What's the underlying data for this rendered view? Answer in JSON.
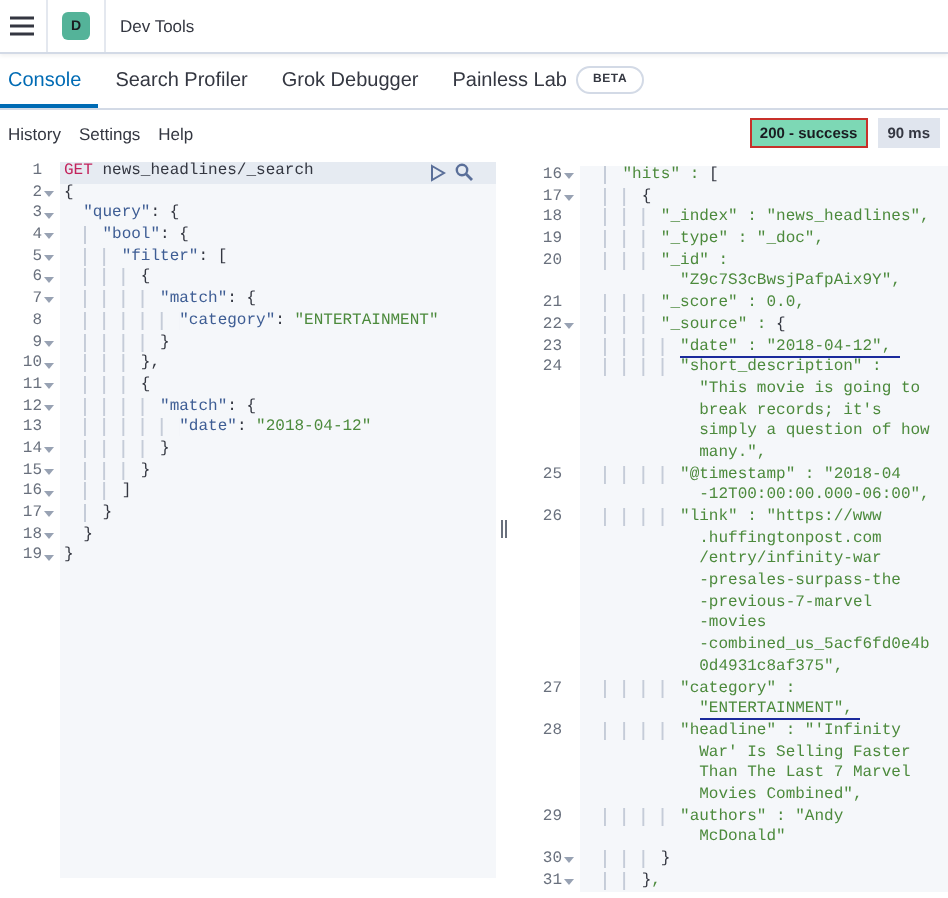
{
  "header": {
    "avatar": "D",
    "title": "Dev Tools"
  },
  "tabs": [
    {
      "label": "Console",
      "selected": true
    },
    {
      "label": "Search Profiler",
      "selected": false
    },
    {
      "label": "Grok Debugger",
      "selected": false
    },
    {
      "label": "Painless Lab",
      "selected": false,
      "badge": "BETA"
    }
  ],
  "toolbar": {
    "links": [
      "History",
      "Settings",
      "Help"
    ],
    "status": {
      "text": "200 - success",
      "outlined": true
    },
    "time": "90 ms"
  },
  "request": {
    "num": "1",
    "method": "GET",
    "path": "news_headlines/_search",
    "lines": [
      {
        "num": "2",
        "foldable": true,
        "text": "{"
      },
      {
        "num": "3",
        "foldable": true,
        "text": "  \"query\": {"
      },
      {
        "num": "4",
        "foldable": true,
        "text": "    \"bool\": {"
      },
      {
        "num": "5",
        "foldable": true,
        "text": "      \"filter\": ["
      },
      {
        "num": "6",
        "foldable": true,
        "text": "        {"
      },
      {
        "num": "7",
        "foldable": true,
        "text": "          \"match\": {"
      },
      {
        "num": "8",
        "foldable": false,
        "text": "            \"category\": \"ENTERTAINMENT\""
      },
      {
        "num": "9",
        "foldable": true,
        "text": "          }"
      },
      {
        "num": "10",
        "foldable": true,
        "text": "        },"
      },
      {
        "num": "11",
        "foldable": true,
        "text": "        {"
      },
      {
        "num": "12",
        "foldable": true,
        "text": "          \"match\": {"
      },
      {
        "num": "13",
        "foldable": false,
        "text": "            \"date\": \"2018-04-12\""
      },
      {
        "num": "14",
        "foldable": true,
        "text": "          }"
      },
      {
        "num": "15",
        "foldable": true,
        "text": "        }"
      },
      {
        "num": "16",
        "foldable": true,
        "text": "      ]"
      },
      {
        "num": "17",
        "foldable": true,
        "text": "    }"
      },
      {
        "num": "18",
        "foldable": true,
        "text": "  }"
      },
      {
        "num": "19",
        "foldable": true,
        "text": "}"
      }
    ]
  },
  "response": {
    "lines": [
      {
        "num": "16",
        "foldable": true,
        "underlined": false,
        "text": [
          "    \"hits\" : ["
        ]
      },
      {
        "num": "17",
        "foldable": true,
        "underlined": false,
        "text": [
          "      {"
        ]
      },
      {
        "num": "18",
        "foldable": false,
        "underlined": false,
        "text": [
          "        \"_index\" : \"news_headlines\","
        ]
      },
      {
        "num": "19",
        "foldable": false,
        "underlined": false,
        "text": [
          "        \"_type\" : \"_doc\","
        ]
      },
      {
        "num": "20",
        "foldable": false,
        "underlined": false,
        "text": [
          "        \"_id\" :",
          "          \"Z9c7S3cBwsjPafpAix9Y\","
        ]
      },
      {
        "num": "21",
        "foldable": false,
        "underlined": false,
        "text": [
          "        \"_score\" : 0.0,"
        ]
      },
      {
        "num": "22",
        "foldable": true,
        "underlined": false,
        "text": [
          "        \"_source\" : {"
        ]
      },
      {
        "num": "23",
        "foldable": false,
        "underlined": true,
        "text": [
          "          \"date\" : \"2018-04-12\","
        ]
      },
      {
        "num": "24",
        "foldable": false,
        "underlined": false,
        "text": [
          "          \"short_description\" :",
          "            \"This movie is going to",
          "            break records; it's",
          "            simply a question of how",
          "            many.\","
        ]
      },
      {
        "num": "25",
        "foldable": false,
        "underlined": false,
        "text": [
          "          \"@timestamp\" : \"2018-04",
          "            -12T00:00:00.000-06:00\","
        ]
      },
      {
        "num": "26",
        "foldable": false,
        "underlined": false,
        "text": [
          "          \"link\" : \"https://www",
          "            .huffingtonpost.com",
          "            /entry/infinity-war",
          "            -presales-surpass-the",
          "            -previous-7-marvel",
          "            -movies",
          "            -combined_us_5acf6fd0e4b",
          "            0d4931c8af375\","
        ]
      },
      {
        "num": "27",
        "foldable": false,
        "underlined": true,
        "text": [
          "          \"category\" :",
          "            \"ENTERTAINMENT\","
        ]
      },
      {
        "num": "28",
        "foldable": false,
        "underlined": false,
        "text": [
          "          \"headline\" : \"'Infinity",
          "            War' Is Selling Faster",
          "            Than The Last 7 Marvel",
          "            Movies Combined\","
        ]
      },
      {
        "num": "29",
        "foldable": false,
        "underlined": false,
        "text": [
          "          \"authors\" : \"Andy",
          "            McDonald\""
        ]
      },
      {
        "num": "30",
        "foldable": true,
        "underlined": false,
        "text": [
          "        }"
        ]
      },
      {
        "num": "31",
        "foldable": true,
        "underlined": false,
        "text": [
          "      },"
        ]
      }
    ]
  }
}
